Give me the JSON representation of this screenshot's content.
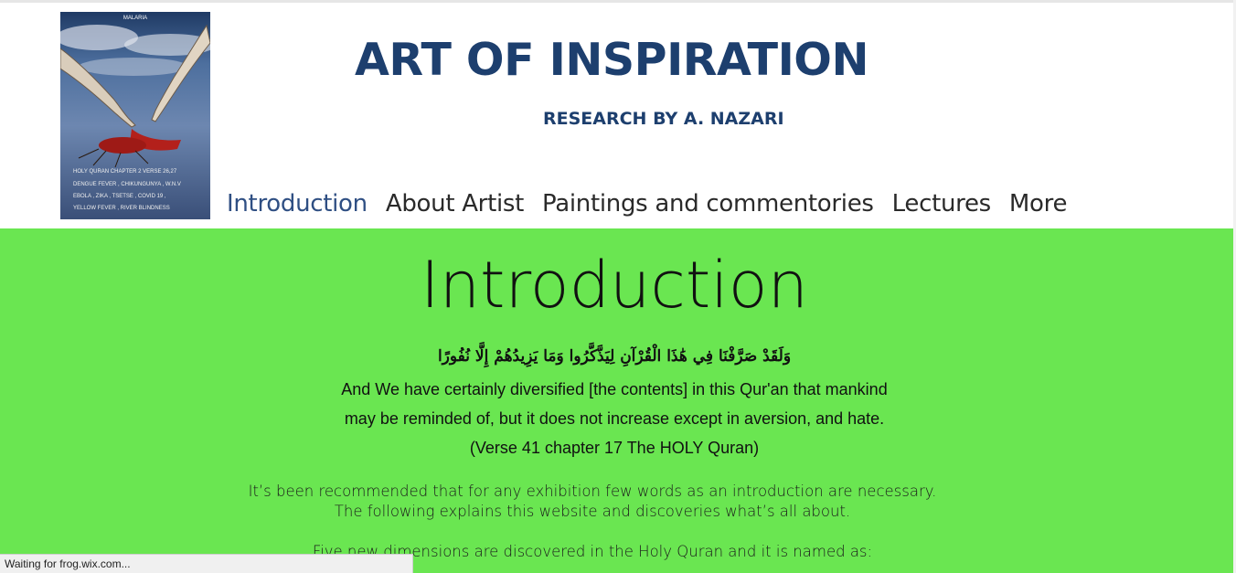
{
  "header": {
    "title": "ART OF INSPIRATION",
    "subtitle": "RESEARCH BY A. NAZARI",
    "painting": {
      "caption_top": "MALARIA",
      "lines": [
        "HOLY QURAN CHAPTER 2 VERSE 26,27",
        "DENGUE FEVER , CHIKUNGUNYA , W.N.V",
        "EBOLA , ZIKA , TSETSE , COVID 19 ,",
        "YELLOW FEVER , RIVER BLINDNESS"
      ]
    }
  },
  "nav": {
    "items": [
      {
        "label": "Introduction",
        "active": true
      },
      {
        "label": "About Artist"
      },
      {
        "label": "Paintings and commentories"
      },
      {
        "label": "Lectures"
      },
      {
        "label": "More"
      }
    ]
  },
  "content": {
    "title": "Introduction",
    "arabic": "وَلَقَدْ صَرَّفْنَا فِي هَٰذَا الْقُرْآنِ لِيَذَّكَّرُوا وَمَا يَزِيدُهُمْ إِلَّا نُفُورًا",
    "verse_lines": [
      "And We have certainly diversified [the contents] in this Qur'an that mankind",
      "may be reminded of, but it does not increase except in aversion, and hate.",
      "(Verse 41 chapter 17 The HOLY Quran)"
    ],
    "para1_line1": "It’s been recommended that for any exhibition few words as an introduction are necessary.",
    "para1_line2": "The following explains this website and discoveries what’s all about.",
    "para2": "Five new dimensions are discovered in the Holy Quran and it is named as:"
  },
  "status_bar": {
    "text": "Waiting for frog.wix.com..."
  },
  "colors": {
    "title": "#1d3f6e",
    "content_bg": "#6ae651",
    "nav_active": "#2f4f83"
  }
}
